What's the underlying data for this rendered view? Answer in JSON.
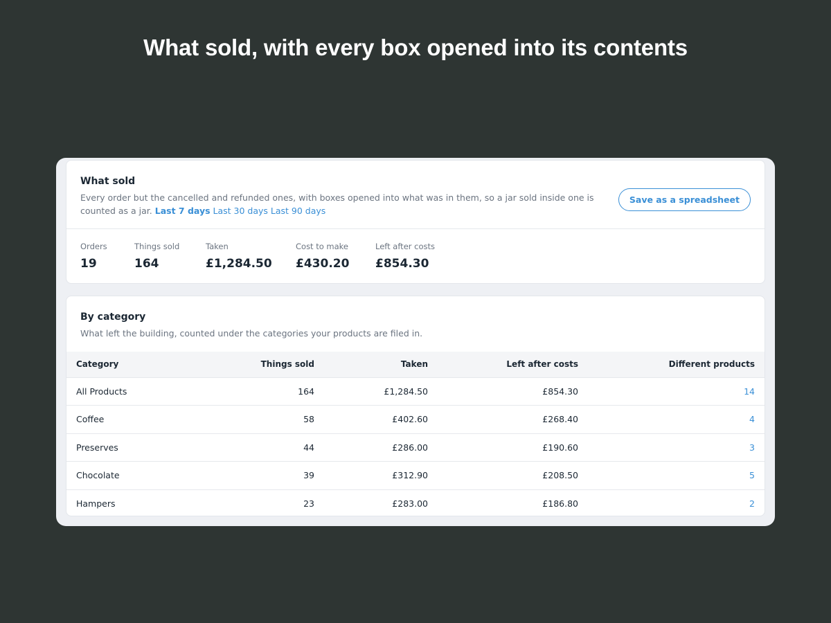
{
  "headline": "What sold, with every box opened into its contents",
  "summary": {
    "title": "What sold",
    "description": "Every order but the cancelled and refunded ones, with boxes opened into what was in them, so a jar sold inside one is counted as a jar.",
    "ranges": [
      {
        "label": "Last 7 days",
        "active": true
      },
      {
        "label": "Last 30 days",
        "active": false
      },
      {
        "label": "Last 90 days",
        "active": false
      }
    ],
    "export_label": "Save as a spreadsheet",
    "stats": [
      {
        "label": "Orders",
        "value": "19"
      },
      {
        "label": "Things sold",
        "value": "164"
      },
      {
        "label": "Taken",
        "value": "£1,284.50"
      },
      {
        "label": "Cost to make",
        "value": "£430.20"
      },
      {
        "label": "Left after costs",
        "value": "£854.30"
      }
    ]
  },
  "category": {
    "title": "By category",
    "description": "What left the building, counted under the categories your products are filed in.",
    "columns": [
      "Category",
      "Things sold",
      "Taken",
      "Left after costs",
      "Different products"
    ],
    "rows": [
      [
        "All Products",
        "164",
        "£1,284.50",
        "£854.30",
        "14"
      ],
      [
        "Coffee",
        "58",
        "£402.60",
        "£268.40",
        "4"
      ],
      [
        "Preserves",
        "44",
        "£286.00",
        "£190.60",
        "3"
      ],
      [
        "Chocolate",
        "39",
        "£312.90",
        "£208.50",
        "5"
      ],
      [
        "Hampers",
        "23",
        "£283.00",
        "£186.80",
        "2"
      ]
    ]
  }
}
